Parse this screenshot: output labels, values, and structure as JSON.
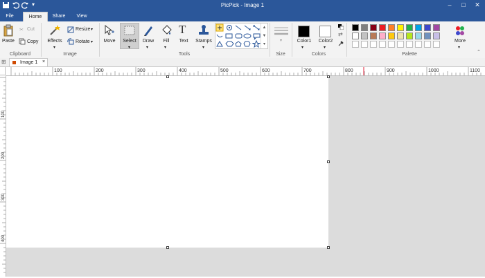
{
  "window": {
    "title": "PicPick - Image 1"
  },
  "tabs": [
    {
      "label": "File"
    },
    {
      "label": "Home"
    },
    {
      "label": "Share"
    },
    {
      "label": "View"
    }
  ],
  "ribbon": {
    "clipboard": {
      "paste": "Paste",
      "cut": "Cut",
      "copy": "Copy",
      "label": "Clipboard"
    },
    "image": {
      "effects": "Effects",
      "resize": "Resize",
      "rotate": "Rotate",
      "label": "Image"
    },
    "tools": {
      "move": "Move",
      "select": "Select",
      "draw": "Draw",
      "fill": "Fill",
      "text": "Text",
      "stamps": "Stamps",
      "label": "Tools"
    },
    "size": {
      "label": "Size"
    },
    "colors": {
      "color1": "Color1",
      "color2": "Color2",
      "label": "Colors",
      "color1_value": "#000000",
      "color2_value": "#ffffff"
    },
    "palette": {
      "label": "Palette",
      "more": "More",
      "row1": [
        "#000000",
        "#7f7f7f",
        "#880015",
        "#ed1c24",
        "#ff7f27",
        "#fff200",
        "#22b14c",
        "#00a2e8",
        "#3f48cc",
        "#a349a4"
      ],
      "row2": [
        "#ffffff",
        "#c3c3c3",
        "#b97a57",
        "#ffaec9",
        "#ffc90e",
        "#efe4b0",
        "#b5e61d",
        "#99d9ea",
        "#7092be",
        "#c8bfe7"
      ],
      "row3": [
        "#ffffff",
        "#ffffff",
        "#ffffff",
        "#ffffff",
        "#ffffff",
        "#ffffff",
        "#ffffff",
        "#ffffff",
        "#ffffff",
        "#ffffff"
      ]
    }
  },
  "document_tab": {
    "label": "Image 1"
  },
  "ruler": {
    "ticks": [
      "100",
      "200",
      "300",
      "400",
      "500",
      "600",
      "700",
      "800",
      "900",
      "1000",
      "1100"
    ]
  },
  "vruler": {
    "ticks": [
      "100",
      "200",
      "300",
      "400"
    ]
  }
}
